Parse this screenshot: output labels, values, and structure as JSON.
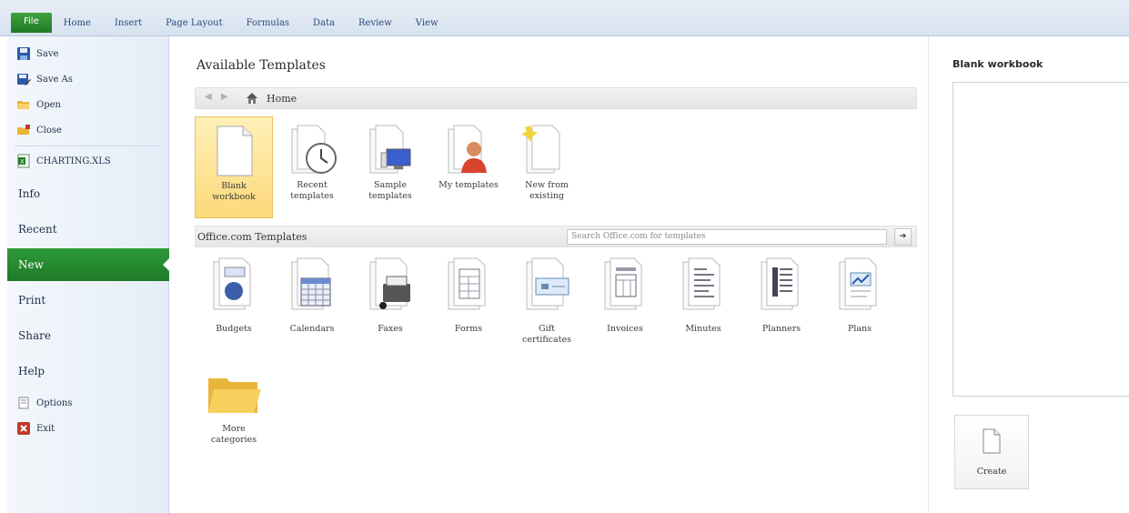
{
  "ribbon": {
    "tabs": [
      "File",
      "Home",
      "Insert",
      "Page Layout",
      "Formulas",
      "Data",
      "Review",
      "View"
    ]
  },
  "sidebar": {
    "items": [
      {
        "label": "Save",
        "icon": "save-icon"
      },
      {
        "label": "Save As",
        "icon": "save-as-icon"
      },
      {
        "label": "Open",
        "icon": "open-folder-icon"
      },
      {
        "label": "Close",
        "icon": "close-folder-icon"
      },
      {
        "label": "CHARTING.XLS",
        "icon": "excel-file-icon"
      }
    ],
    "sections": [
      {
        "label": "Info"
      },
      {
        "label": "Recent"
      },
      {
        "label": "New"
      },
      {
        "label": "Print"
      },
      {
        "label": "Share"
      },
      {
        "label": "Help"
      }
    ],
    "bottom": [
      {
        "label": "Options",
        "icon": "options-icon"
      },
      {
        "label": "Exit",
        "icon": "exit-icon"
      }
    ]
  },
  "main": {
    "title": "Available Templates",
    "nav": {
      "home_label": "Home"
    },
    "templates": [
      {
        "line1": "Blank",
        "line2": "workbook",
        "icon": "blank-workbook-icon",
        "selected": true
      },
      {
        "line1": "Recent",
        "line2": "templates",
        "icon": "recent-templates-icon"
      },
      {
        "line1": "Sample",
        "line2": "templates",
        "icon": "sample-templates-icon"
      },
      {
        "line1": "My templates",
        "line2": "",
        "icon": "my-templates-icon"
      },
      {
        "line1": "New from",
        "line2": "existing",
        "icon": "new-from-existing-icon"
      }
    ],
    "office": {
      "title": "Office.com Templates",
      "search_placeholder": "Search Office.com for templates",
      "categories": [
        {
          "line1": "Budgets",
          "line2": "",
          "icon": "budgets-icon"
        },
        {
          "line1": "Calendars",
          "line2": "",
          "icon": "calendars-icon"
        },
        {
          "line1": "Faxes",
          "line2": "",
          "icon": "faxes-icon"
        },
        {
          "line1": "Forms",
          "line2": "",
          "icon": "forms-icon"
        },
        {
          "line1": "Gift",
          "line2": "certificates",
          "icon": "gift-certificates-icon"
        },
        {
          "line1": "Invoices",
          "line2": "",
          "icon": "invoices-icon"
        },
        {
          "line1": "Minutes",
          "line2": "",
          "icon": "minutes-icon"
        },
        {
          "line1": "Planners",
          "line2": "",
          "icon": "planners-icon"
        },
        {
          "line1": "Plans",
          "line2": "",
          "icon": "plans-icon"
        },
        {
          "line1": "More",
          "line2": "categories",
          "icon": "folder-icon"
        }
      ]
    }
  },
  "right": {
    "title": "Blank workbook",
    "create_label": "Create"
  },
  "colors": {
    "accent_green": "#1f7a27",
    "selected_yellow": "#fcd97a"
  }
}
